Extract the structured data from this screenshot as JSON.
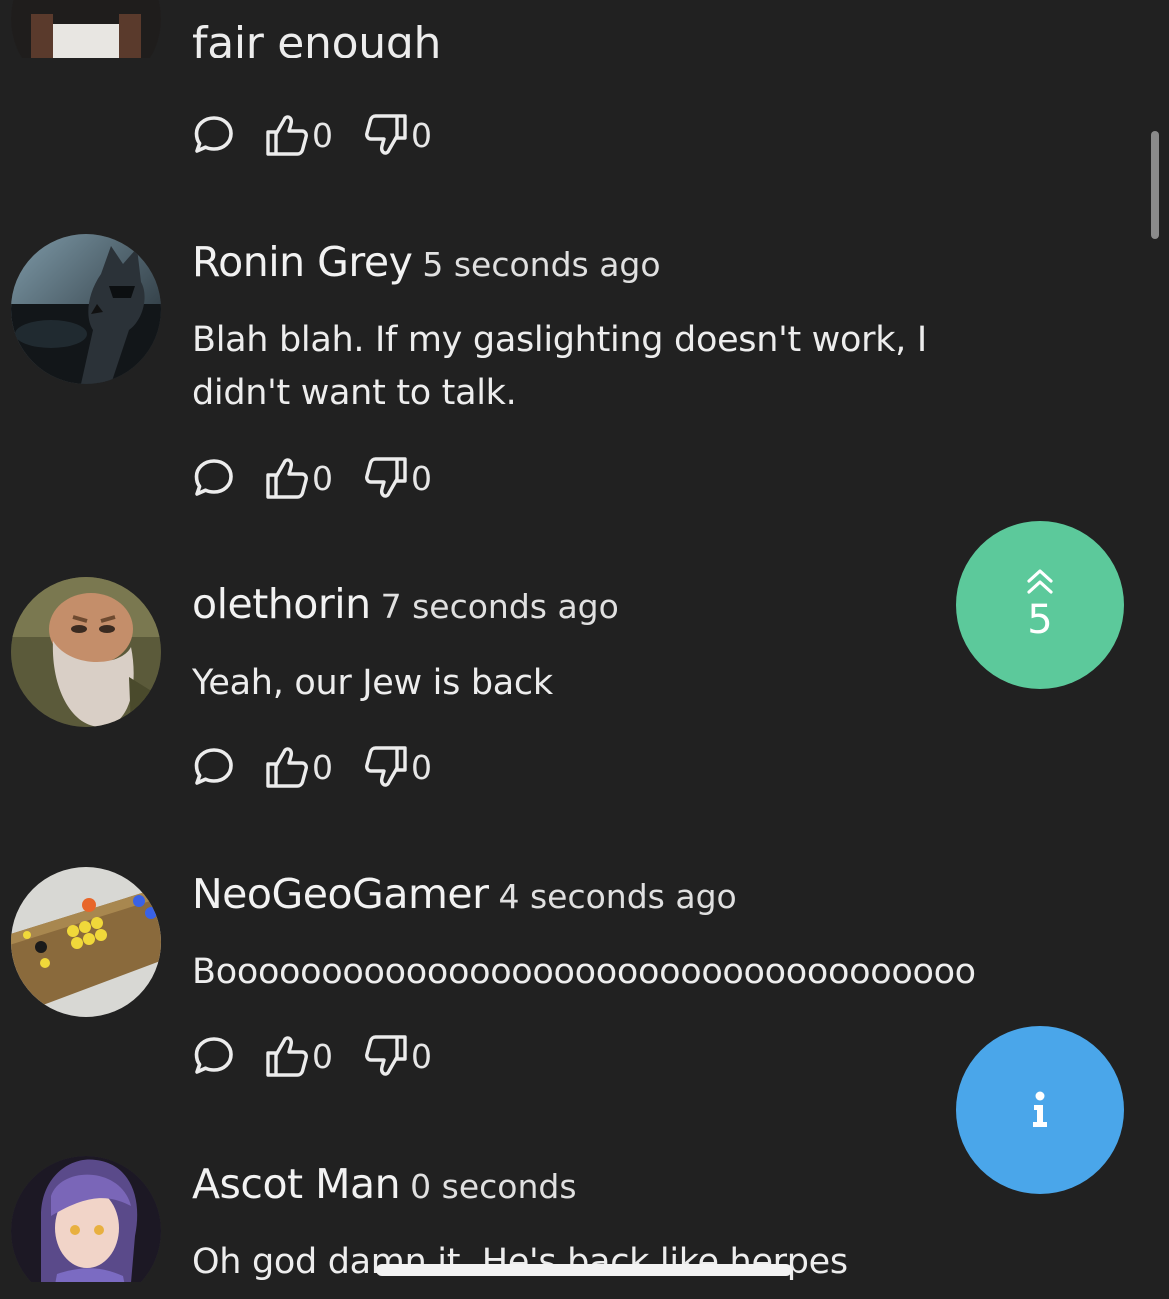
{
  "comments": [
    {
      "author": "",
      "timestamp": "",
      "text": "fair enough",
      "replies_label": "reply",
      "likes": "0",
      "dislikes": "0"
    },
    {
      "author": "Ronin Grey",
      "timestamp": "5 seconds ago",
      "text": "Blah blah. If my gaslighting doesn't work, I didn't want to talk.",
      "likes": "0",
      "dislikes": "0"
    },
    {
      "author": "olethorin",
      "timestamp": "7 seconds ago",
      "text": "Yeah, our Jew is back",
      "likes": "0",
      "dislikes": "0"
    },
    {
      "author": "NeoGeoGamer",
      "timestamp": "4 seconds ago",
      "text": "Boooooooooooooooooooooooooooooooooooo",
      "likes": "0",
      "dislikes": "0"
    },
    {
      "author": "Ascot Man",
      "timestamp": "0 seconds",
      "text": "Oh god damn it. He's back like herpes"
    }
  ],
  "new_comments_button": {
    "count": "5",
    "icon": "chevron-double-up-icon",
    "color": "#5cc99b"
  },
  "info_button": {
    "label": "i",
    "icon": "info-icon",
    "color": "#4aa6ea"
  },
  "theme": {
    "background": "#212121",
    "text": "#ececec"
  }
}
